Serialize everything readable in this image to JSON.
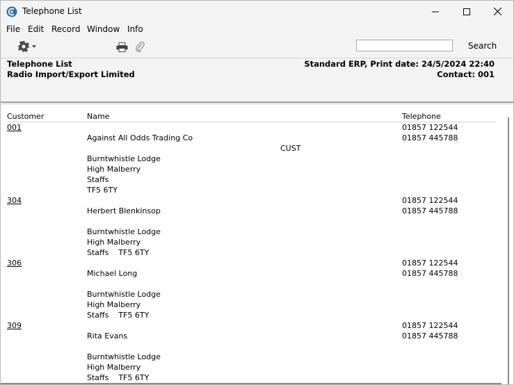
{
  "window": {
    "title": "Telephone List",
    "controls": [
      "minimize",
      "maximize",
      "close"
    ]
  },
  "menu": {
    "items": [
      "File",
      "Edit",
      "Record",
      "Window",
      "Info"
    ]
  },
  "toolbar": {
    "search_placeholder": "",
    "search_label": "Search",
    "icons": [
      "gear-icon",
      "print-icon",
      "paperclip-icon"
    ]
  },
  "header": {
    "report_title": "Telephone List",
    "company": "Radio Import/Export Limited",
    "print_info": "Standard ERP, Print date: 24/5/2024 22:40",
    "contact": "Contact: 001"
  },
  "columns": {
    "customer": "Customer",
    "name": "Name",
    "telephone": "Telephone"
  },
  "records": [
    {
      "customer": "001",
      "phone1": "01857 122544",
      "name": "Against All Odds Trading Co",
      "phone2": "01857 445788",
      "extra": "CUST",
      "address1": "Burntwhistle Lodge",
      "address2": "High Malberry",
      "address3": "Staffs",
      "address4": "TF5 6TY"
    },
    {
      "customer": "304",
      "phone1": "01857 122544",
      "name": "Herbert Blenkinsop",
      "phone2": "01857 445788",
      "address1": "Burntwhistle Lodge",
      "address2": "High Malberry",
      "address3": "Staffs    TF5 6TY"
    },
    {
      "customer": "306",
      "phone1": "01857 122544",
      "name": "Michael Long",
      "phone2": "01857 445788",
      "address1": "Burntwhistle Lodge",
      "address2": "High Malberry",
      "address3": "Staffs    TF5 6TY"
    },
    {
      "customer": "309",
      "phone1": "01857 122544",
      "name": "Rita Evans",
      "phone2": "01857 445788",
      "address1": "Burntwhistle Lodge",
      "address2": "High Malberry",
      "address3": "Staffs    TF5 6TY"
    }
  ]
}
